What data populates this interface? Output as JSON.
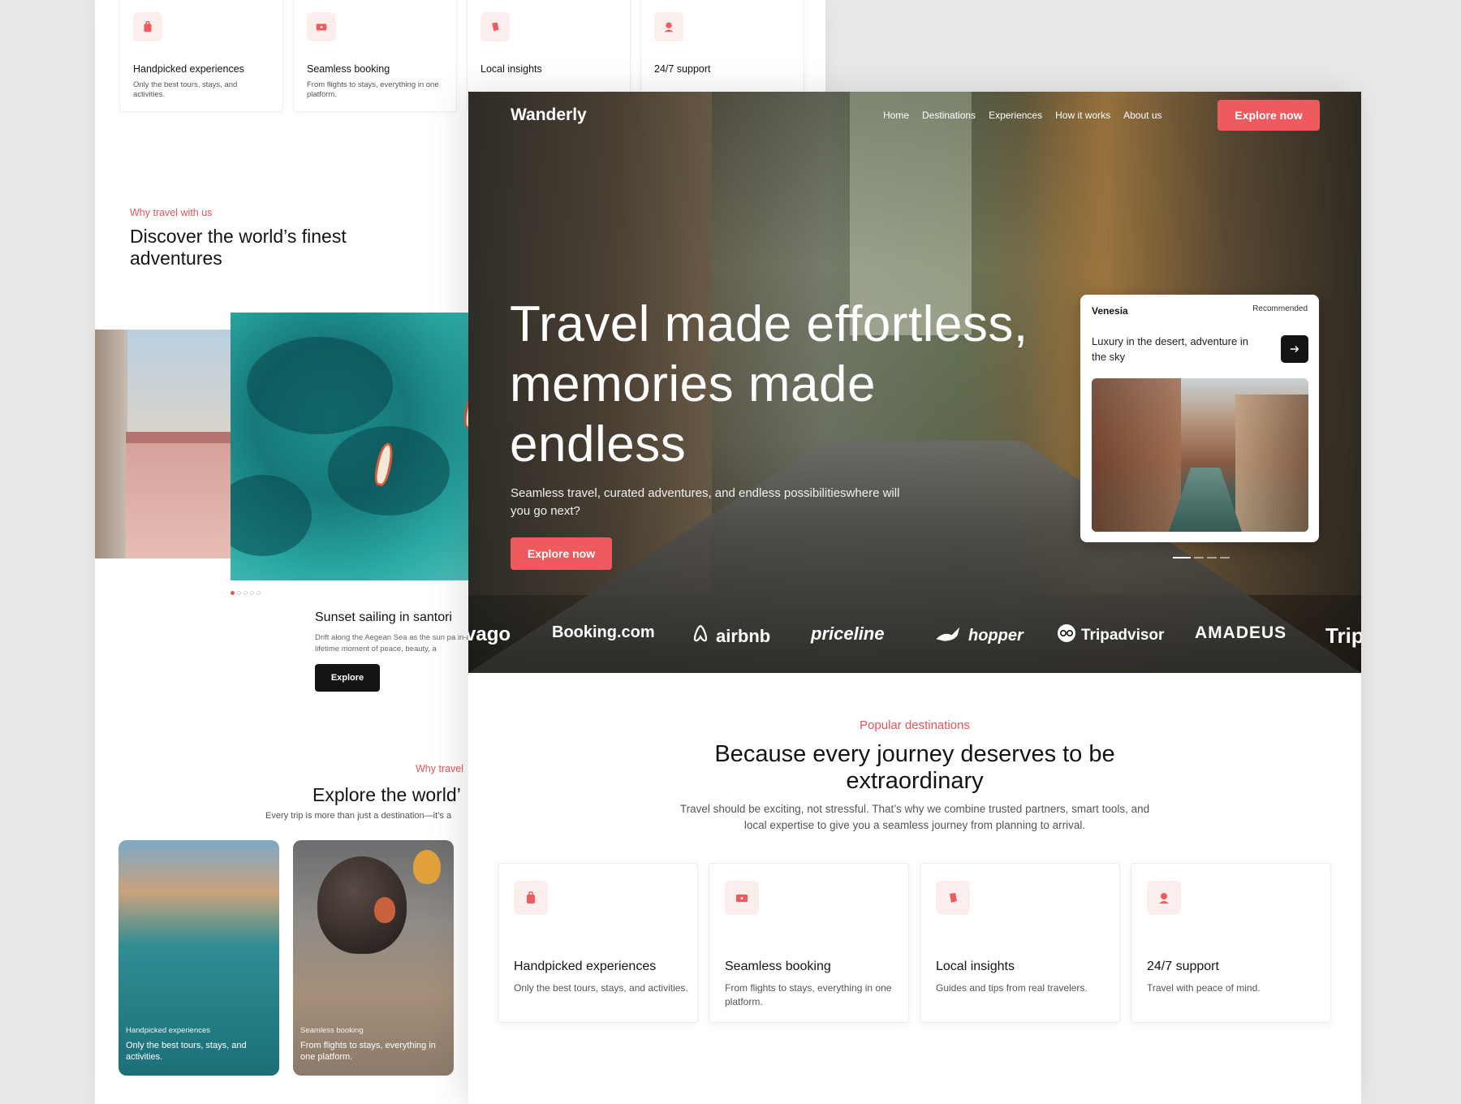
{
  "back_page": {
    "features": [
      {
        "icon": "backpack-icon",
        "title": "Handpicked experiences",
        "desc": "Only the best tours, stays, and activities."
      },
      {
        "icon": "ticket-icon",
        "title": "Seamless booking",
        "desc": "From flights to stays, everything in one platform."
      },
      {
        "icon": "map-pin-icon",
        "title": "Local insights",
        "desc": ""
      },
      {
        "icon": "support-icon",
        "title": "24/7 support",
        "desc": ""
      }
    ],
    "why_eyebrow": "Why travel with us",
    "why_heading": "Discover the world’s finest adventures",
    "sunset_title": "Sunset sailing in santori",
    "sunset_desc": "Drift along the Aegean Sea as the sun pa in-a-lifetime moment of peace, beauty, a",
    "explore_label": "Explore",
    "why2_eyebrow": "Why travel",
    "explore_world": "Explore the world’",
    "every_trip": "Every trip is more than just a destination—it’s a",
    "cards": [
      {
        "cap_small": "Handpicked experiences",
        "cap_large": "Only the best tours, stays, and activities."
      },
      {
        "cap_small": "Seamless booking",
        "cap_large": "From flights to stays, everything in one platform."
      }
    ]
  },
  "nav": {
    "logo": "Wanderly",
    "links": [
      "Home",
      "Destinations",
      "Experiences",
      "How it works",
      "About us"
    ],
    "cta": "Explore now"
  },
  "hero": {
    "title": "Travel made effortless, memories made endless",
    "subtitle": "Seamless travel, curated adventures, and endless possibilitieswhere will you go next?",
    "cta": "Explore now"
  },
  "recommended": {
    "name": "Venesia",
    "tag": "Recommended",
    "desc": "Luxury in the desert, adventure in the sky"
  },
  "partners": [
    "vago",
    "Booking.com",
    "airbnb",
    "priceline",
    "hopper",
    "Tripadvisor",
    "AMADEUS",
    "Trip"
  ],
  "popular": {
    "eyebrow": "Popular destinations",
    "heading": "Because every journey deserves to be extraordinary",
    "desc": "Travel should be exciting, not stressful. That’s why we combine trusted partners, smart tools, and local expertise to give you a seamless journey from planning to arrival.",
    "features": [
      {
        "icon": "backpack-icon",
        "title": "Handpicked experiences",
        "desc": "Only the best tours, stays, and activities."
      },
      {
        "icon": "ticket-icon",
        "title": "Seamless booking",
        "desc": "From flights to stays, everything in one platform."
      },
      {
        "icon": "map-pin-icon",
        "title": "Local insights",
        "desc": "Guides and tips from real travelers."
      },
      {
        "icon": "support-icon",
        "title": "24/7 support",
        "desc": "Travel with peace of mind."
      }
    ]
  },
  "colors": {
    "accent": "#ef5a5f",
    "dark": "#141414"
  }
}
